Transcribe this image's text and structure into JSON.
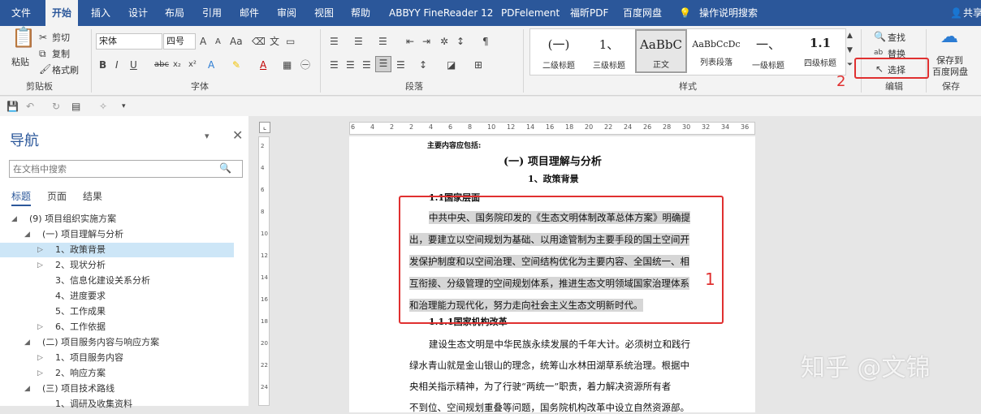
{
  "menubar": {
    "tabs": [
      "文件",
      "开始",
      "插入",
      "设计",
      "布局",
      "引用",
      "邮件",
      "审阅",
      "视图",
      "帮助",
      "ABBYY FineReader 12",
      "PDFelement",
      "福昕PDF",
      "百度网盘"
    ],
    "tell_me": "操作说明搜索",
    "share": "共享"
  },
  "clipboard": {
    "paste": "粘贴",
    "cut": "剪切",
    "copy": "复制",
    "format_painter": "格式刷",
    "group": "剪贴板"
  },
  "font": {
    "name": "宋体",
    "size": "四号",
    "group": "字体",
    "grow": "A",
    "shrink": "A",
    "aa": "Aa",
    "bold": "B",
    "italic": "I",
    "underline": "U",
    "strike": "abc",
    "sub": "x₂",
    "sup": "x²",
    "color_a": "A",
    "char_a": "A"
  },
  "paragraph": {
    "group": "段落"
  },
  "styles": {
    "items": [
      {
        "preview": "(一)",
        "name": "二级标题"
      },
      {
        "preview": "1、",
        "name": "三级标题"
      },
      {
        "preview": "AaBbC",
        "name": "正文"
      },
      {
        "preview": "AaBbCcDc",
        "name": "列表段落"
      },
      {
        "preview": "一、",
        "name": "一级标题"
      },
      {
        "preview": "1.1",
        "name": "四级标题"
      }
    ],
    "group": "样式"
  },
  "editing": {
    "find": "查找",
    "replace": "替换",
    "select": "选择",
    "group": "编辑"
  },
  "save": {
    "label1": "保存到",
    "label2": "百度网盘",
    "group": "保存"
  },
  "navigation": {
    "title": "导航",
    "search_placeholder": "在文档中搜索",
    "tabs": [
      "标题",
      "页面",
      "结果"
    ],
    "items": [
      {
        "label": "(9) 项目组织实施方案",
        "arrow": "◢",
        "selected": false
      },
      {
        "label": "(一) 项目理解与分析",
        "arrow": "◢",
        "selected": false
      },
      {
        "label": "1、政策背景",
        "arrow": "▷",
        "selected": true
      },
      {
        "label": "2、现状分析",
        "arrow": "▷",
        "selected": false
      },
      {
        "label": "3、信息化建设关系分析",
        "arrow": "",
        "selected": false
      },
      {
        "label": "4、进度要求",
        "arrow": "",
        "selected": false
      },
      {
        "label": "5、工作成果",
        "arrow": "",
        "selected": false
      },
      {
        "label": "6、工作依据",
        "arrow": "▷",
        "selected": false
      },
      {
        "label": "(二) 项目服务内容与响应方案",
        "arrow": "◢",
        "selected": false
      },
      {
        "label": "1、项目服务内容",
        "arrow": "▷",
        "selected": false
      },
      {
        "label": "2、响应方案",
        "arrow": "▷",
        "selected": false
      },
      {
        "label": "(三) 项目技术路线",
        "arrow": "◢",
        "selected": false
      },
      {
        "label": "1、调研及收集资料",
        "arrow": "",
        "selected": false
      }
    ]
  },
  "ruler": {
    "h": [
      "6",
      "4",
      "2",
      "2",
      "4",
      "6",
      "8",
      "10",
      "12",
      "14",
      "16",
      "18",
      "20",
      "22",
      "24",
      "26",
      "28",
      "30",
      "32",
      "34",
      "36"
    ],
    "v": [
      "2",
      "4",
      "6",
      "8",
      "10",
      "12",
      "14",
      "16",
      "18",
      "20",
      "22",
      "24"
    ]
  },
  "document": {
    "top_note": "主要内容应包括:",
    "h1": "(一) 项目理解与分析",
    "h2": "1、政策背景",
    "h3": "1.1国家层面",
    "para1": [
      "中共中央、国务院印发的《生态文明体制改革总体方案》明确提",
      "出，要建立以空间规划为基础、以用途管制为主要手段的国土空间开",
      "发保护制度和以空间治理、空间结构优化为主要内容、全国统一、相",
      "互衔接、分级管理的空间规划体系，推进生态文明领域国家治理体系",
      "和治理能力现代化，努力走向社会主义生态文明新时代。"
    ],
    "h4": "1.1.1国家机构改革",
    "para2": [
      "建设生态文明是中华民族永续发展的千年大计。必须树立和践行",
      "绿水青山就是金山银山的理念，统筹山水林田湖草系统治理。根据中",
      "央相关指示精神，为了行驶“两统一”职责，着力解决资源所有者",
      "不到位、空间规划重叠等问题，国务院机构改革中设立自然资源部。"
    ]
  },
  "annotations": {
    "box1_label": "1",
    "box2_label": "2"
  },
  "watermark": "知乎 @文锦"
}
